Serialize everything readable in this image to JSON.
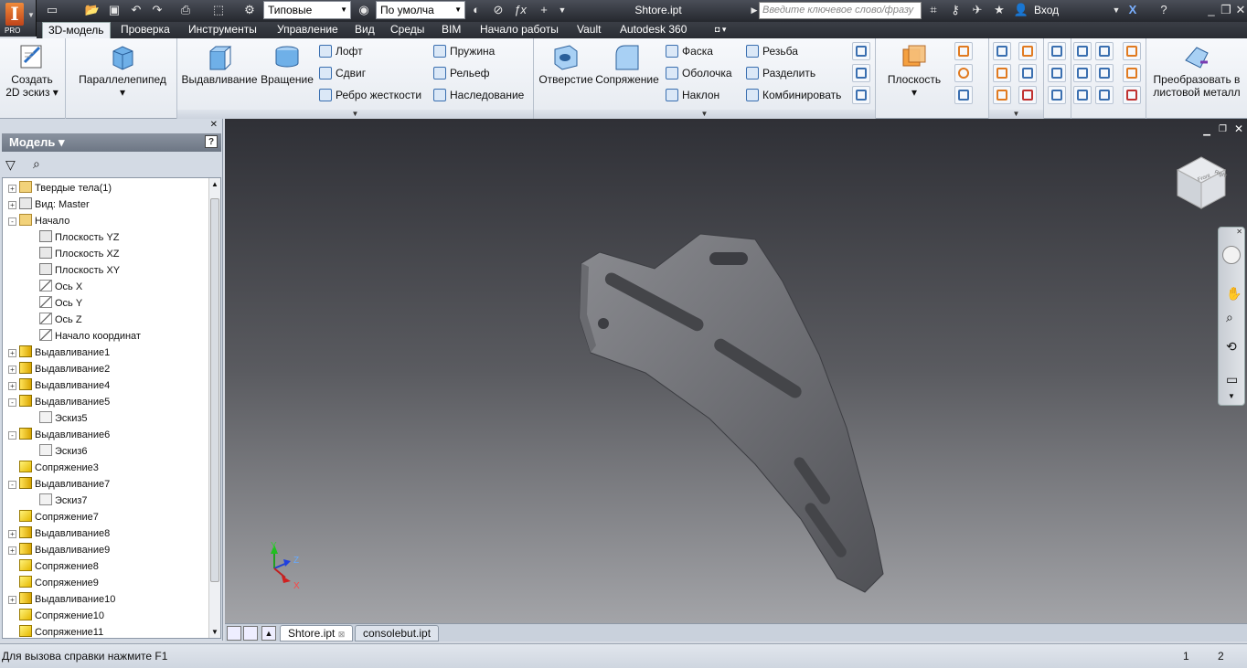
{
  "app": {
    "edition": "PRO"
  },
  "titlebar": {
    "appearance_preset": "Типовые",
    "material_preset": "По умолча",
    "document_title": "Shtore.ipt",
    "search_placeholder": "Введите ключевое слово/фразу",
    "login_label": "Вход"
  },
  "menu": {
    "tabs": [
      "3D-модель",
      "Проверка",
      "Инструменты",
      "Управление",
      "Вид",
      "Среды",
      "BIM",
      "Начало работы",
      "Vault",
      "Autodesk 360"
    ]
  },
  "ribbon": {
    "create_sketch": "Создать\n2D эскиз",
    "create_sketch_line1": "Создать",
    "create_sketch_line2": "2D эскиз",
    "box": "Параллелепипед",
    "extrude": "Выдавливание",
    "revolve": "Вращение",
    "loft": "Лофт",
    "sweep": "Сдвиг",
    "rib": "Ребро жесткости",
    "coil": "Пружина",
    "emboss": "Рельеф",
    "derive": "Наследование",
    "hole": "Отверстие",
    "fillet": "Сопряжение",
    "chamfer": "Фаска",
    "shell": "Оболочка",
    "draft": "Наклон",
    "thread": "Резьба",
    "split": "Разделить",
    "combine": "Комбинировать",
    "plane": "Плоскость",
    "convert_line1": "Преобразовать в",
    "convert_line2": "листовой металл"
  },
  "panel": {
    "title": "Модель",
    "tree": [
      {
        "label": "Твердые тела(1)",
        "icon": "folder-solid",
        "level": 0,
        "toggle": "+"
      },
      {
        "label": "Вид: Master",
        "icon": "view",
        "level": 0,
        "toggle": "+"
      },
      {
        "label": "Начало",
        "icon": "folder",
        "level": 0,
        "toggle": "-"
      },
      {
        "label": "Плоскость YZ",
        "icon": "plane",
        "level": 1,
        "toggle": ""
      },
      {
        "label": "Плоскость XZ",
        "icon": "plane",
        "level": 1,
        "toggle": ""
      },
      {
        "label": "Плоскость XY",
        "icon": "plane",
        "level": 1,
        "toggle": ""
      },
      {
        "label": "Ось X",
        "icon": "axis",
        "level": 1,
        "toggle": ""
      },
      {
        "label": "Ось Y",
        "icon": "axis",
        "level": 1,
        "toggle": ""
      },
      {
        "label": "Ось Z",
        "icon": "axis",
        "level": 1,
        "toggle": ""
      },
      {
        "label": "Начало координат",
        "icon": "point",
        "level": 1,
        "toggle": ""
      },
      {
        "label": "Выдавливание1",
        "icon": "extrude",
        "level": 0,
        "toggle": "+"
      },
      {
        "label": "Выдавливание2",
        "icon": "extrude",
        "level": 0,
        "toggle": "+"
      },
      {
        "label": "Выдавливание4",
        "icon": "extrude",
        "level": 0,
        "toggle": "+"
      },
      {
        "label": "Выдавливание5",
        "icon": "extrude",
        "level": 0,
        "toggle": "-"
      },
      {
        "label": "Эскиз5",
        "icon": "sketch",
        "level": 1,
        "toggle": ""
      },
      {
        "label": "Выдавливание6",
        "icon": "extrude",
        "level": 0,
        "toggle": "-"
      },
      {
        "label": "Эскиз6",
        "icon": "sketch",
        "level": 1,
        "toggle": ""
      },
      {
        "label": "Сопряжение3",
        "icon": "fillet",
        "level": 0,
        "toggle": ""
      },
      {
        "label": "Выдавливание7",
        "icon": "extrude",
        "level": 0,
        "toggle": "-"
      },
      {
        "label": "Эскиз7",
        "icon": "sketch",
        "level": 1,
        "toggle": ""
      },
      {
        "label": "Сопряжение7",
        "icon": "fillet",
        "level": 0,
        "toggle": ""
      },
      {
        "label": "Выдавливание8",
        "icon": "extrude",
        "level": 0,
        "toggle": "+"
      },
      {
        "label": "Выдавливание9",
        "icon": "extrude",
        "level": 0,
        "toggle": "+"
      },
      {
        "label": "Сопряжение8",
        "icon": "fillet",
        "level": 0,
        "toggle": ""
      },
      {
        "label": "Сопряжение9",
        "icon": "fillet",
        "level": 0,
        "toggle": ""
      },
      {
        "label": "Выдавливание10",
        "icon": "extrude",
        "level": 0,
        "toggle": "+"
      },
      {
        "label": "Сопряжение10",
        "icon": "fillet",
        "level": 0,
        "toggle": ""
      },
      {
        "label": "Сопряжение11",
        "icon": "fillet",
        "level": 0,
        "toggle": ""
      }
    ]
  },
  "viewcube": {
    "face_top": "Top",
    "face_left": "Front",
    "face_right": "Right"
  },
  "axis_labels": {
    "y": "Y",
    "z": "Z",
    "x": "X"
  },
  "doc_tabs": [
    {
      "label": "Shtore.ipt",
      "active": true
    },
    {
      "label": "consolebut.ipt",
      "active": false
    }
  ],
  "status": {
    "help_text": "Для вызова справки нажмите F1",
    "count1": "1",
    "count2": "2"
  }
}
